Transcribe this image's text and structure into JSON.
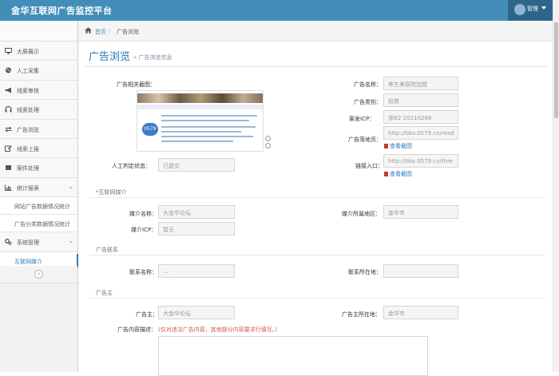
{
  "header": {
    "brand": "金华互联网广告监控平台",
    "user": "管理",
    "accent": "#438eb9"
  },
  "sidebar": {
    "items": [
      {
        "label": "大屏展示",
        "icon": "monitor-icon"
      },
      {
        "label": "人工采集",
        "icon": "globe-icon"
      },
      {
        "label": "线索审核",
        "icon": "bullhorn-icon"
      },
      {
        "label": "线索处理",
        "icon": "headset-icon"
      },
      {
        "label": "广告浏览",
        "icon": "exchange-icon"
      },
      {
        "label": "线索上报",
        "icon": "edit-icon"
      },
      {
        "label": "案件处理",
        "icon": "gavel-icon"
      },
      {
        "label": "统计报表",
        "icon": "bar-chart-icon"
      }
    ],
    "stats_subitems": [
      "网站广告数据情况统计",
      "广告分类数据情况统计"
    ],
    "system": {
      "label": "系统管理",
      "icon": "cogs-icon"
    },
    "system_subitems": [
      "互联网媒介"
    ]
  },
  "breadcrumb": {
    "home": "首页",
    "current": "广告浏览"
  },
  "page": {
    "title": "广告浏览",
    "subtitle": "广告浏览信息"
  },
  "ad_info": {
    "image_label": "广告相关截图：",
    "manual_label": "人工判定状态：",
    "manual_value": "已提交",
    "name_label": "广告名称：",
    "name_value": "养生美容院加盟",
    "category_label": "广告类别：",
    "category_value": "招商",
    "icp_label": "案发ICP：",
    "icp_value": "浙B2-20110266",
    "landing_label": "广告落地页：",
    "landing_value": "http://bbs.0579.cn/read",
    "view_shot_1": "查看截图",
    "entry_label": "链接入口：",
    "entry_value": "http://bbs.0579.cn/thre",
    "view_shot_2": "查看截图"
  },
  "media": {
    "section": "互联网媒介",
    "name_label": "媒介名称：",
    "name_value": "大金华论坛",
    "icp_label": "媒介ICP：",
    "icp_value": "暂无",
    "region_label": "媒介所属地区：",
    "region_value": "金华市"
  },
  "contact": {
    "section": "广告联系",
    "name_label": "联系名称：",
    "name_value": "...",
    "loc_label": "联系所在地：",
    "loc_value": ""
  },
  "advertiser": {
    "section": "广告主",
    "main_label": "广告主：",
    "main_value": "大金华论坛",
    "loc_label": "广告主所在地：",
    "loc_value": "金华市",
    "desc_label": "广告内容描述：",
    "desc_hint": "(仅对违法广告内容，其他部分内容要求行填写。)"
  }
}
